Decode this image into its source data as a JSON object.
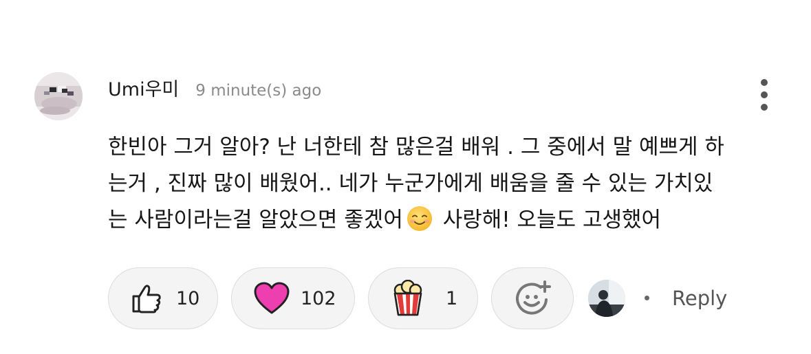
{
  "comment": {
    "author": "Umi우미",
    "timestamp": "9 minute(s) ago",
    "text_lines": [
      "한빈아 그거 알아? 난 너한테 참 많은걸 배워 . 그 중에서 말 예쁘게 하",
      "는거 , 진짜 많이 배웠어.. 네가 누군가에게 배움을 줄 수 있는 가치있",
      "는 사람이라는걸 알았으면 좋겠어"
    ],
    "text_line3_after_emoji": "사랑해! 오늘도 고생했어",
    "inline_emoji": "smiling-face-emoji"
  },
  "reactions": [
    {
      "icon": "thumbs-up-icon",
      "count": "10"
    },
    {
      "icon": "heart-icon",
      "count": "102",
      "color": "#ee3fb0"
    },
    {
      "icon": "popcorn-icon",
      "count": "1",
      "color": "#e23b3b"
    }
  ],
  "actions": {
    "add_reaction_icon": "add-emoji-icon",
    "reply_label": "Reply",
    "more_icon": "more-vertical-icon"
  },
  "colors": {
    "heart": "#ee3fb0",
    "timestamp": "#8a8a8a",
    "pill_bg": "#f4f4f4",
    "pill_border": "#dcdcdc"
  }
}
